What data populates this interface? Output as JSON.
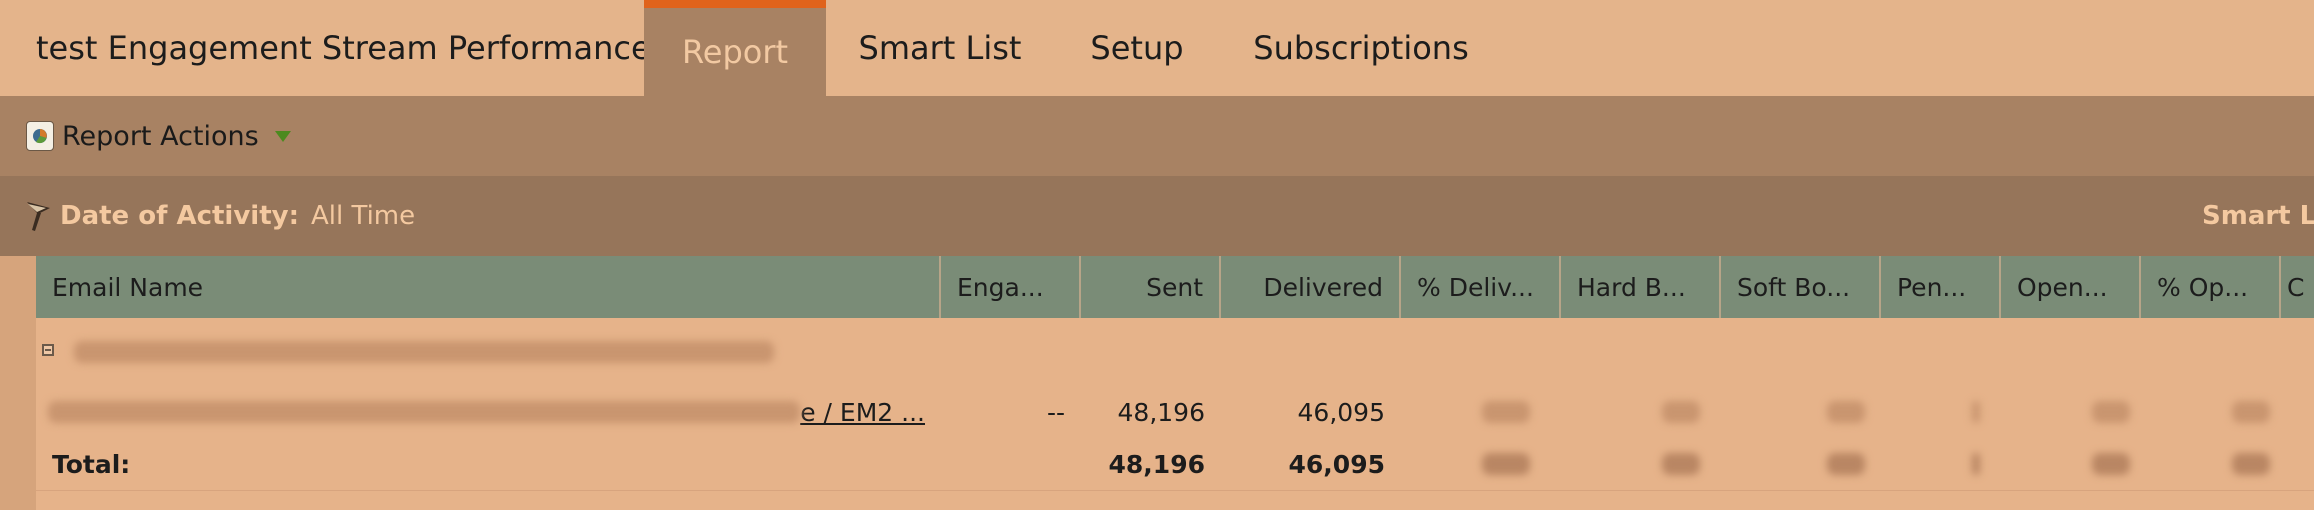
{
  "tabs": {
    "title": "test Engagement Stream Performance",
    "report": "Report",
    "smart_list": "Smart List",
    "setup": "Setup",
    "subscriptions": "Subscriptions"
  },
  "toolbar": {
    "report_actions": "Report Actions",
    "icon": "report-icon"
  },
  "filter": {
    "label": "Date of Activity:",
    "value": "All Time",
    "smart_list_link": "Smart Lis"
  },
  "grid": {
    "columns": [
      "Email Name",
      "Enga...",
      "Sent",
      "Delivered",
      "% Deliv...",
      "Hard B...",
      "Soft Bo...",
      "Pen...",
      "Open...",
      "% Op...",
      "C"
    ],
    "row": {
      "email_name_suffix": "e / EM2 ...",
      "engagement": "--",
      "sent": "48,196",
      "delivered": "46,095"
    },
    "total": {
      "label": "Total:",
      "sent": "48,196",
      "delivered": "46,095"
    }
  },
  "colors": {
    "accent": "#e0631b",
    "header_green": "#7a8c77",
    "toolbar": "#a88263",
    "filterbar": "#96755a"
  }
}
